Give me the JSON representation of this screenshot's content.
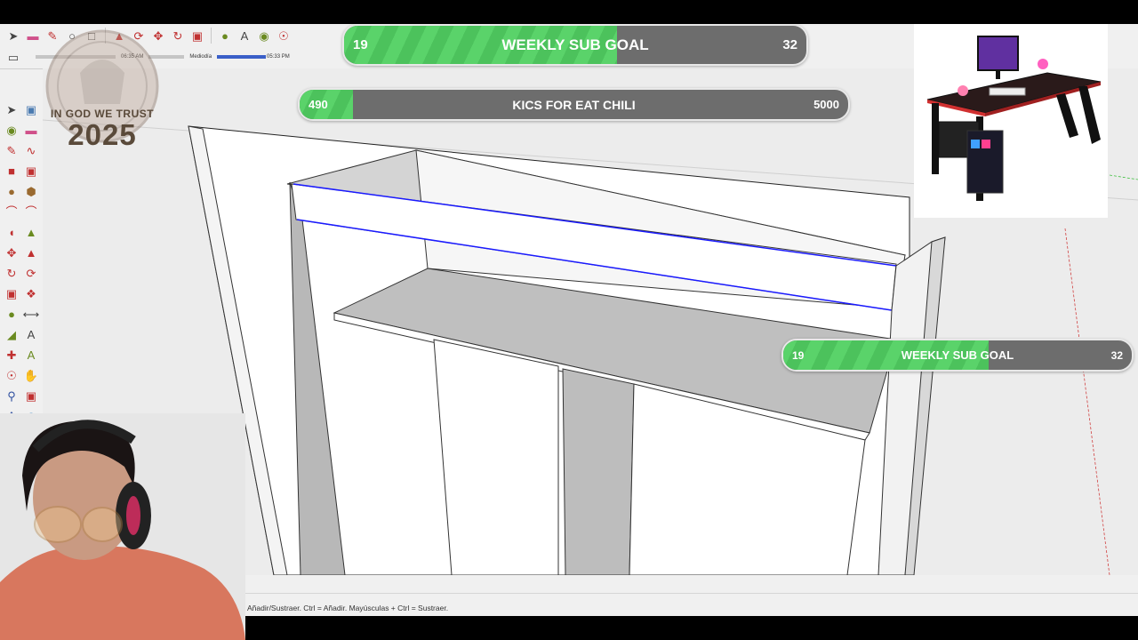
{
  "toolbar": {
    "row1_icons": [
      "select-icon",
      "eraser-icon",
      "pencil-icon",
      "paint-icon",
      "shape-icon",
      "push-pull-icon",
      "follow-me-icon",
      "move-icon",
      "rotate-icon",
      "scale-icon",
      "tape-measure-icon",
      "text-icon",
      "paint-bucket-icon",
      "orbit-icon"
    ],
    "row2_icons": [
      "eraser-small-icon"
    ],
    "time_start": "06:35 AM",
    "time_mid": "Mediodía",
    "time_end": "05:33 PM",
    "right_icons": [
      "component-icon",
      "style-icon",
      "layer-icon",
      "outline-icon",
      "section-icon",
      "warehouse-icon"
    ]
  },
  "left_toolbar": {
    "icons": [
      "select-icon",
      "component-icon",
      "paint-bucket-icon",
      "eraser-icon",
      "line-icon",
      "freehand-icon",
      "rectangle-icon",
      "rotated-rect-icon",
      "circle-icon",
      "polygon-icon",
      "arc-icon",
      "arc-3pt-icon",
      "pie-icon",
      "sandbox-icon",
      "move-icon",
      "push-pull-icon",
      "rotate-icon",
      "follow-me-icon",
      "scale-icon",
      "offset-icon",
      "tape-measure-icon",
      "dimension-icon",
      "protractor-icon",
      "text-icon",
      "axes-icon",
      "3d-text-icon",
      "orbit-icon",
      "pan-icon",
      "zoom-icon",
      "zoom-window-icon",
      "zoom-extents-icon",
      "walk-icon",
      "position-camera-icon",
      "look-around-icon",
      "section-plane-icon",
      "layers-icon"
    ]
  },
  "watermark": {
    "motto": "IN GOD WE TRUST",
    "year": "2025"
  },
  "goals": [
    {
      "id": "weekly-sub-top",
      "title": "WEEKLY SUB GOAL",
      "current": "19",
      "max": "32",
      "progress": 0.59
    },
    {
      "id": "kics-chili",
      "title": "KICS FOR EAT CHILI",
      "current": "490",
      "max": "5000",
      "progress": 0.098
    },
    {
      "id": "weekly-sub-right",
      "title": "WEEKLY SUB GOAL",
      "current": "19",
      "max": "32",
      "progress": 0.59
    }
  ],
  "status": {
    "hint": "Añadir/Sustraer. Ctrl = Añadir. Mayúsculas + Ctrl = Sustraer."
  },
  "colors": {
    "goal_fill": "#5ad36a",
    "goal_track": "#6d6d6d",
    "selection_edge": "#1a1aff",
    "axis_red": "#d04040",
    "axis_green": "#40c040"
  }
}
